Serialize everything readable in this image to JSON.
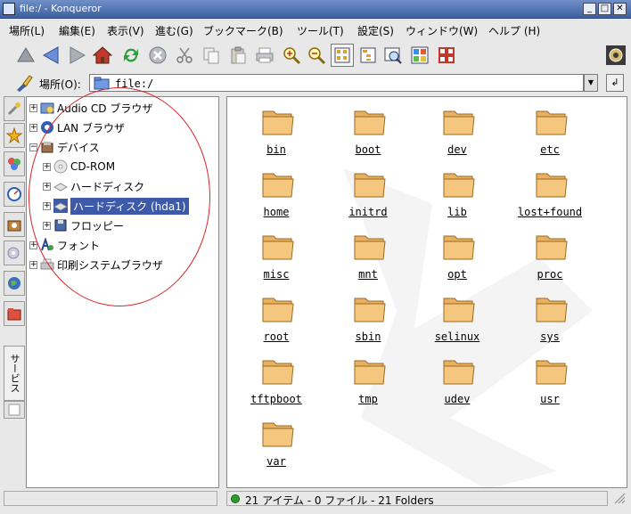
{
  "window": {
    "title": "file:/ - Konqueror",
    "min_label": "_",
    "max_label": "□",
    "close_label": "✕"
  },
  "menu": [
    "場所(L)",
    "編集(E)",
    "表示(V)",
    "進む(G)",
    "ブックマーク(B)",
    "ツール(T)",
    "設定(S)",
    "ウィンドウ(W)",
    "ヘルプ (H)"
  ],
  "toolbar": {
    "icons": [
      "up-arrow-icon",
      "back-arrow-icon",
      "forward-arrow-icon",
      "home-icon",
      "reload-icon",
      "stop-icon",
      "cut-icon",
      "copy-icon",
      "paste-icon",
      "print-icon",
      "zoom-in-icon",
      "zoom-out-icon",
      "icon-view-icon",
      "tree-view-icon",
      "preview-icon",
      "info-list-icon",
      "multi-column-icon"
    ]
  },
  "location": {
    "label": "場所(O):",
    "value": "file:/"
  },
  "sidebar": {
    "tabs": [
      "tools-icon",
      "bookmarks-icon",
      "network-icon",
      "history-icon",
      "home-folder-icon",
      "devices-icon",
      "web-icon",
      "folder-icon"
    ],
    "services_label": "サービス",
    "tree": [
      {
        "label": "Audio CD ブラウザ",
        "expand": "+",
        "icon": "audio-cd"
      },
      {
        "label": "LAN ブラウザ",
        "expand": "+",
        "icon": "lan"
      },
      {
        "label": "デバイス",
        "expand": "−",
        "icon": "devices"
      },
      {
        "label": "CD-ROM",
        "expand": "+",
        "icon": "cdrom"
      },
      {
        "label": "ハードディスク",
        "expand": "+",
        "icon": "hdd"
      },
      {
        "label": "ハードディスク (hda1)",
        "expand": "+",
        "icon": "hdd",
        "selected": true
      },
      {
        "label": "フロッピー",
        "expand": "+",
        "icon": "floppy"
      },
      {
        "label": "フォント",
        "expand": "+",
        "icon": "fonts"
      },
      {
        "label": "印刷システムブラウザ",
        "expand": "+",
        "icon": "printer"
      }
    ]
  },
  "files": [
    "bin",
    "boot",
    "dev",
    "etc",
    "home",
    "initrd",
    "lib",
    "lost+found",
    "misc",
    "mnt",
    "opt",
    "proc",
    "root",
    "sbin",
    "selinux",
    "sys",
    "tftpboot",
    "tmp",
    "udev",
    "usr",
    "var"
  ],
  "status": {
    "text": "21 アイテム - 0 ファイル - 21 Folders"
  },
  "colors": {
    "selection": "#3c5aa8",
    "folder": "#f5c77e",
    "annotation": "#d9262a",
    "titlebar": "#3d5fa3"
  }
}
